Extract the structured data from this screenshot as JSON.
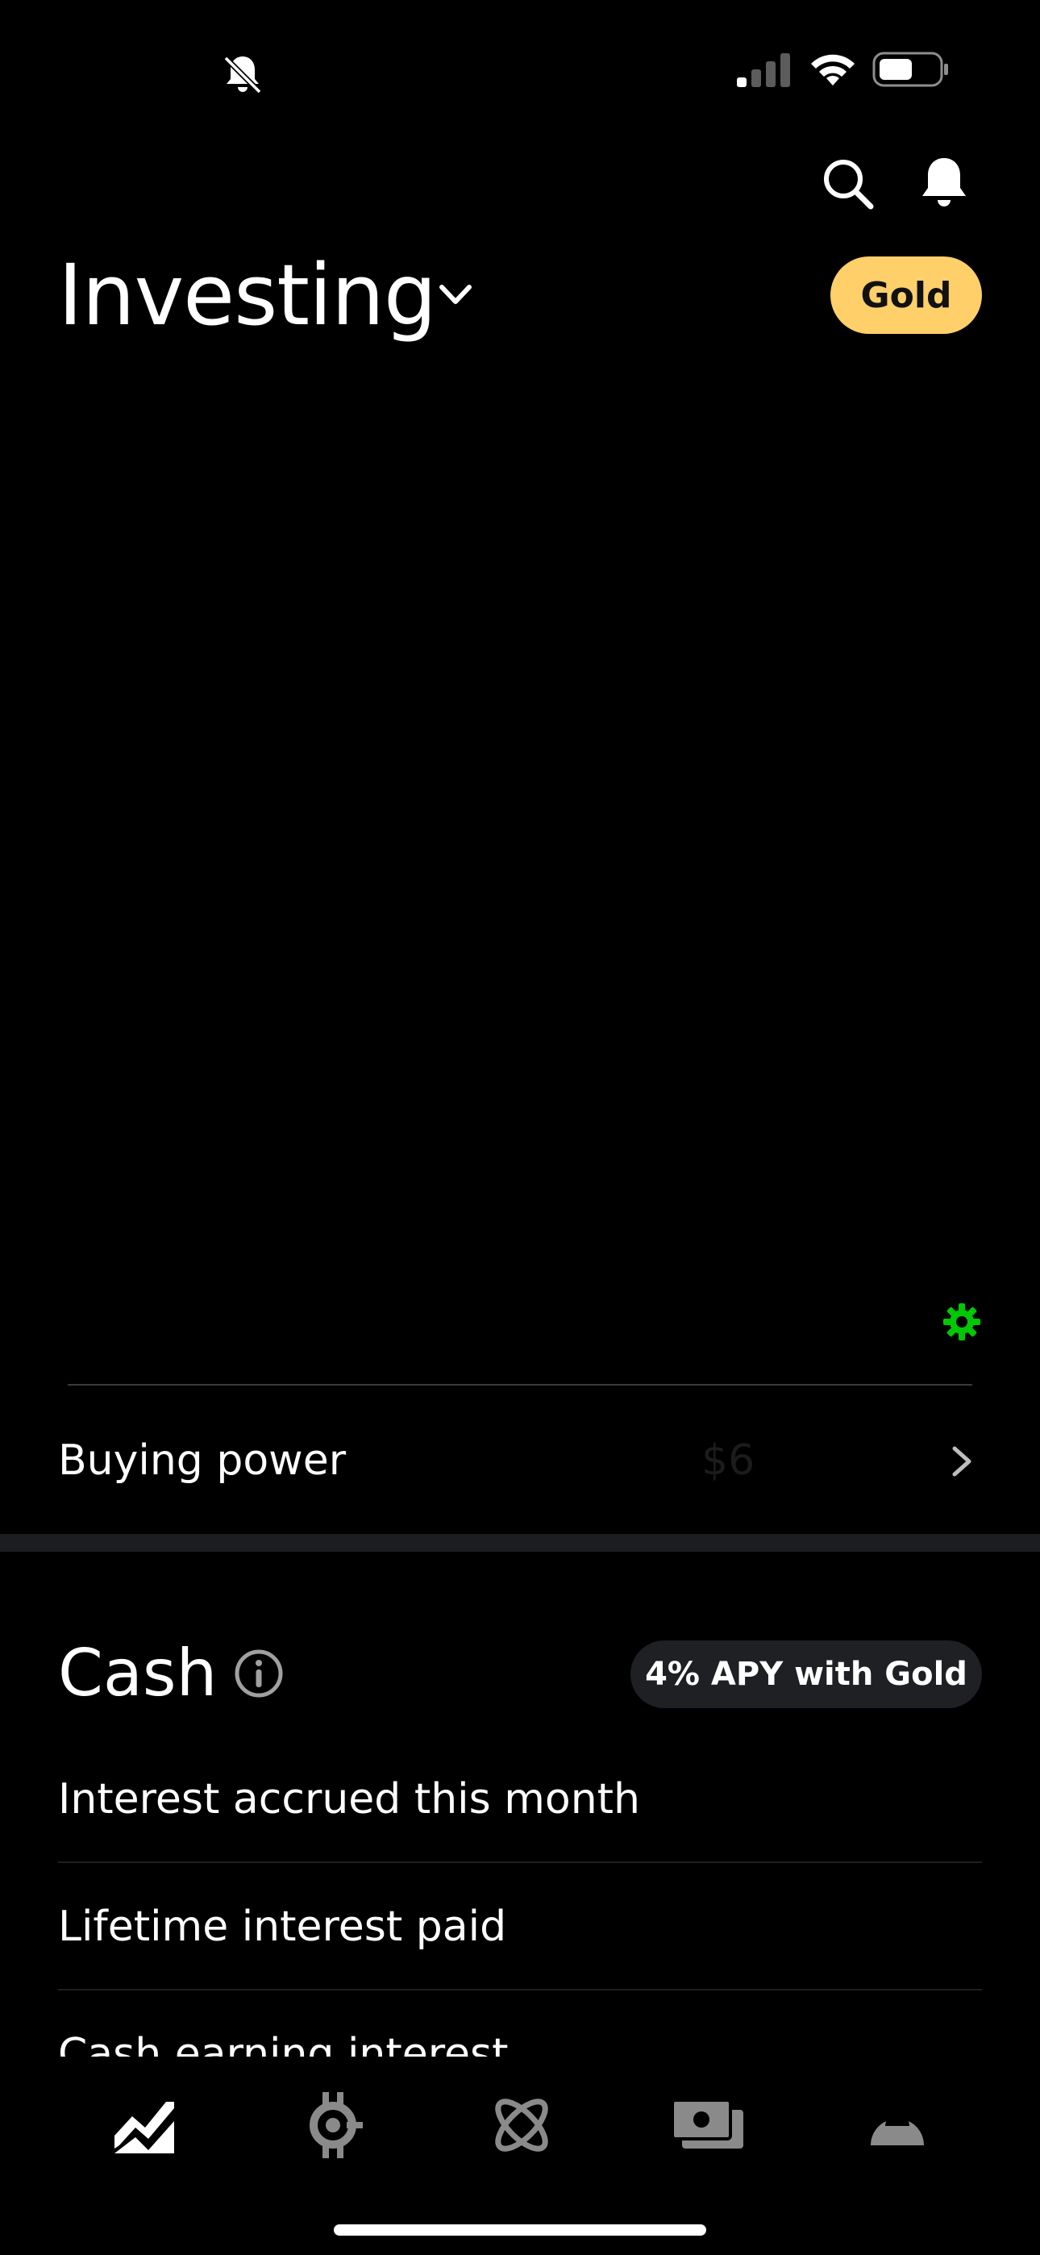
{
  "header": {
    "title": "Investing",
    "membership_badge": "Gold"
  },
  "buying_power": {
    "label": "Buying power",
    "value": "$6"
  },
  "cash": {
    "title": "Cash",
    "apy_badge": "4% APY with Gold",
    "rows": [
      {
        "label": "Interest accrued this month"
      },
      {
        "label": "Lifetime interest paid"
      },
      {
        "label": "Cash earning interest"
      }
    ]
  },
  "colors": {
    "background": "#000000",
    "gold": "#ffcf6a",
    "accent_green": "#00c805",
    "pill_dark": "#1e2023"
  },
  "icons": {
    "status": [
      "bell-slash-icon",
      "cellular-signal-icon",
      "wifi-icon",
      "battery-icon"
    ],
    "header": [
      "search-icon",
      "bell-icon",
      "chevron-down-icon"
    ],
    "tabs": [
      "investing-tab-icon",
      "crypto-tab-icon",
      "discover-tab-icon",
      "cash-tab-icon",
      "account-tab-icon"
    ]
  }
}
